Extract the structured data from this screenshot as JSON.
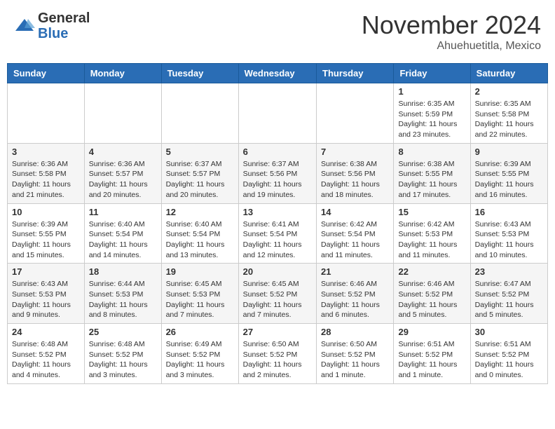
{
  "header": {
    "logo_general": "General",
    "logo_blue": "Blue",
    "month_title": "November 2024",
    "location": "Ahuehuetitla, Mexico"
  },
  "weekdays": [
    "Sunday",
    "Monday",
    "Tuesday",
    "Wednesday",
    "Thursday",
    "Friday",
    "Saturday"
  ],
  "weeks": [
    [
      {
        "day": "",
        "info": ""
      },
      {
        "day": "",
        "info": ""
      },
      {
        "day": "",
        "info": ""
      },
      {
        "day": "",
        "info": ""
      },
      {
        "day": "",
        "info": ""
      },
      {
        "day": "1",
        "info": "Sunrise: 6:35 AM\nSunset: 5:59 PM\nDaylight: 11 hours and 23 minutes."
      },
      {
        "day": "2",
        "info": "Sunrise: 6:35 AM\nSunset: 5:58 PM\nDaylight: 11 hours and 22 minutes."
      }
    ],
    [
      {
        "day": "3",
        "info": "Sunrise: 6:36 AM\nSunset: 5:58 PM\nDaylight: 11 hours and 21 minutes."
      },
      {
        "day": "4",
        "info": "Sunrise: 6:36 AM\nSunset: 5:57 PM\nDaylight: 11 hours and 20 minutes."
      },
      {
        "day": "5",
        "info": "Sunrise: 6:37 AM\nSunset: 5:57 PM\nDaylight: 11 hours and 20 minutes."
      },
      {
        "day": "6",
        "info": "Sunrise: 6:37 AM\nSunset: 5:56 PM\nDaylight: 11 hours and 19 minutes."
      },
      {
        "day": "7",
        "info": "Sunrise: 6:38 AM\nSunset: 5:56 PM\nDaylight: 11 hours and 18 minutes."
      },
      {
        "day": "8",
        "info": "Sunrise: 6:38 AM\nSunset: 5:55 PM\nDaylight: 11 hours and 17 minutes."
      },
      {
        "day": "9",
        "info": "Sunrise: 6:39 AM\nSunset: 5:55 PM\nDaylight: 11 hours and 16 minutes."
      }
    ],
    [
      {
        "day": "10",
        "info": "Sunrise: 6:39 AM\nSunset: 5:55 PM\nDaylight: 11 hours and 15 minutes."
      },
      {
        "day": "11",
        "info": "Sunrise: 6:40 AM\nSunset: 5:54 PM\nDaylight: 11 hours and 14 minutes."
      },
      {
        "day": "12",
        "info": "Sunrise: 6:40 AM\nSunset: 5:54 PM\nDaylight: 11 hours and 13 minutes."
      },
      {
        "day": "13",
        "info": "Sunrise: 6:41 AM\nSunset: 5:54 PM\nDaylight: 11 hours and 12 minutes."
      },
      {
        "day": "14",
        "info": "Sunrise: 6:42 AM\nSunset: 5:54 PM\nDaylight: 11 hours and 11 minutes."
      },
      {
        "day": "15",
        "info": "Sunrise: 6:42 AM\nSunset: 5:53 PM\nDaylight: 11 hours and 11 minutes."
      },
      {
        "day": "16",
        "info": "Sunrise: 6:43 AM\nSunset: 5:53 PM\nDaylight: 11 hours and 10 minutes."
      }
    ],
    [
      {
        "day": "17",
        "info": "Sunrise: 6:43 AM\nSunset: 5:53 PM\nDaylight: 11 hours and 9 minutes."
      },
      {
        "day": "18",
        "info": "Sunrise: 6:44 AM\nSunset: 5:53 PM\nDaylight: 11 hours and 8 minutes."
      },
      {
        "day": "19",
        "info": "Sunrise: 6:45 AM\nSunset: 5:53 PM\nDaylight: 11 hours and 7 minutes."
      },
      {
        "day": "20",
        "info": "Sunrise: 6:45 AM\nSunset: 5:52 PM\nDaylight: 11 hours and 7 minutes."
      },
      {
        "day": "21",
        "info": "Sunrise: 6:46 AM\nSunset: 5:52 PM\nDaylight: 11 hours and 6 minutes."
      },
      {
        "day": "22",
        "info": "Sunrise: 6:46 AM\nSunset: 5:52 PM\nDaylight: 11 hours and 5 minutes."
      },
      {
        "day": "23",
        "info": "Sunrise: 6:47 AM\nSunset: 5:52 PM\nDaylight: 11 hours and 5 minutes."
      }
    ],
    [
      {
        "day": "24",
        "info": "Sunrise: 6:48 AM\nSunset: 5:52 PM\nDaylight: 11 hours and 4 minutes."
      },
      {
        "day": "25",
        "info": "Sunrise: 6:48 AM\nSunset: 5:52 PM\nDaylight: 11 hours and 3 minutes."
      },
      {
        "day": "26",
        "info": "Sunrise: 6:49 AM\nSunset: 5:52 PM\nDaylight: 11 hours and 3 minutes."
      },
      {
        "day": "27",
        "info": "Sunrise: 6:50 AM\nSunset: 5:52 PM\nDaylight: 11 hours and 2 minutes."
      },
      {
        "day": "28",
        "info": "Sunrise: 6:50 AM\nSunset: 5:52 PM\nDaylight: 11 hours and 1 minute."
      },
      {
        "day": "29",
        "info": "Sunrise: 6:51 AM\nSunset: 5:52 PM\nDaylight: 11 hours and 1 minute."
      },
      {
        "day": "30",
        "info": "Sunrise: 6:51 AM\nSunset: 5:52 PM\nDaylight: 11 hours and 0 minutes."
      }
    ]
  ]
}
